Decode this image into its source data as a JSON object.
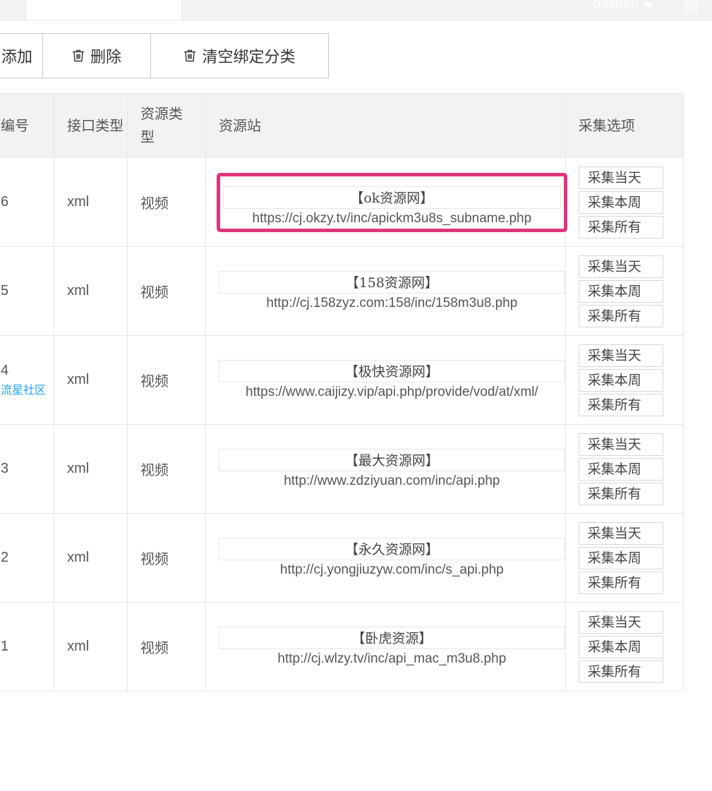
{
  "topbar": {
    "username": "dashen",
    "more": "网站"
  },
  "toolbar": {
    "add_label": "添加",
    "delete_label": "删除",
    "clear_label": "清空绑定分类"
  },
  "table": {
    "headers": [
      "编号",
      "接口类型",
      "资源类型",
      "资源站",
      "采集选项"
    ],
    "rows": [
      {
        "id": "6",
        "sub": "",
        "api": "xml",
        "type": "视频",
        "site_name": "【ok资源网】",
        "site_url": "https://cj.okzy.tv/inc/apickm3u8s_subname.php",
        "highlight": true
      },
      {
        "id": "5",
        "sub": "",
        "api": "xml",
        "type": "视频",
        "site_name": "【158资源网】",
        "site_url": "http://cj.158zyz.com:158/inc/158m3u8.php",
        "highlight": false
      },
      {
        "id": "4",
        "sub": "流星社区",
        "api": "xml",
        "type": "视频",
        "site_name": "【极快资源网】",
        "site_url": "https://www.caijizy.vip/api.php/provide/vod/at/xml/",
        "highlight": false
      },
      {
        "id": "3",
        "sub": "",
        "api": "xml",
        "type": "视频",
        "site_name": "【最大资源网】",
        "site_url": "http://www.zdziyuan.com/inc/api.php",
        "highlight": false
      },
      {
        "id": "2",
        "sub": "",
        "api": "xml",
        "type": "视频",
        "site_name": "【永久资源网】",
        "site_url": "http://cj.yongjiuzyw.com/inc/s_api.php",
        "highlight": false
      },
      {
        "id": "1",
        "sub": "",
        "api": "xml",
        "type": "视频",
        "site_name": "【卧虎资源】",
        "site_url": "http://cj.wlzy.tv/inc/api_mac_m3u8.php",
        "highlight": false
      }
    ],
    "options": [
      "采集当天",
      "采集本周",
      "采集所有"
    ]
  },
  "colors": {
    "highlight": "#e0357a",
    "link": "#1e9fff"
  }
}
